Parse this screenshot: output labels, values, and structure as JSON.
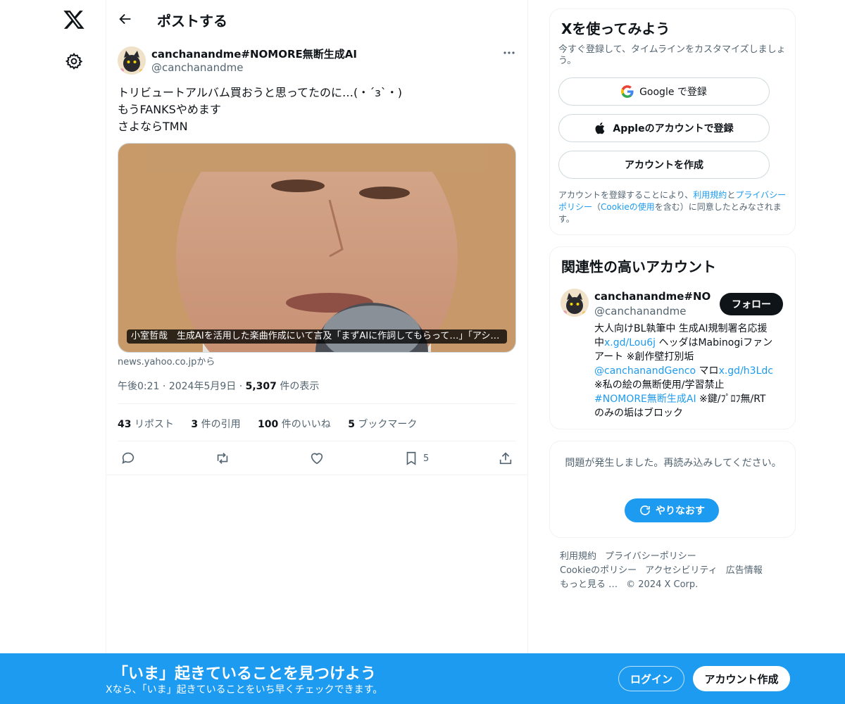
{
  "nav": {
    "logo_icon": "x-logo-icon",
    "settings_icon": "gear-icon"
  },
  "header": {
    "title": "ポストする"
  },
  "post": {
    "author_name": "canchanandme#NOMORE無断生成AI",
    "author_handle": "@canchanandme",
    "text_lines": [
      "トリビュートアルバム買おうと思ってたのに…(・´з`・)",
      "もうFANKSやめます",
      "さよならTMN"
    ],
    "card_caption": "小室哲哉　生成AIを活用した楽曲作成にいて言及「まずAIに作詞してもらって…」「アシ…",
    "card_source": "news.yahoo.co.jpから",
    "time": "午後0:21",
    "date": "2024年5月9日",
    "views_count": "5,307",
    "views_label": "件の表示",
    "stats": [
      {
        "count": "43",
        "label": "リポスト"
      },
      {
        "count": "3",
        "label": "件の引用"
      },
      {
        "count": "100",
        "label": "件のいいね"
      },
      {
        "count": "5",
        "label": "ブックマーク"
      }
    ],
    "bookmark_count": "5"
  },
  "signup_panel": {
    "title": "Xを使ってみよう",
    "subtitle": "今すぐ登録して、タイムラインをカスタマイズしましょう。",
    "google_label": "Google で登録",
    "apple_label": "Appleのアカウントで登録",
    "create_label": "アカウントを作成",
    "legal_1": "アカウントを登録することにより、",
    "legal_terms": "利用規約",
    "legal_2": "と",
    "legal_privacy": "プライバシーポリシー",
    "legal_3": "（",
    "legal_cookie": "Cookieの使用",
    "legal_4": "を含む）に同意したとみなされます。"
  },
  "related_panel": {
    "title": "関連性の高いアカウント",
    "name": "canchanandme#NOMORE無断生成AI",
    "handle": "@canchanandme",
    "follow_label": "フォロー",
    "bio_l1": "大人向けBL執筆中 生成AI規制署名応援",
    "bio_l2a": "中",
    "bio_l2link": "x.gd/Lou6j",
    "bio_l2b": " ヘッダはMabinogiファン",
    "bio_l3": "アート ※創作壁打別垢",
    "bio_l4link1": "@canchanandGenco",
    "bio_l4mid": " マロ",
    "bio_l4link2": "x.gd/h3Ldc",
    "bio_l5": "※私の絵の無断使用/学習禁止",
    "bio_l6link": "#NOMORE無断生成AI",
    "bio_l6b": " ※鍵/ﾌﾟﾛﾌ無/RT",
    "bio_l7": "のみの垢はブロック"
  },
  "error_panel": {
    "message": "問題が発生しました。再読み込みしてください。",
    "retry_label": "やりなおす"
  },
  "footer": {
    "links": [
      "利用規約",
      "プライバシーポリシー",
      "Cookieのポリシー",
      "アクセシビリティ",
      "広告情報",
      "もっと見る …"
    ],
    "copyright": "© 2024 X Corp."
  },
  "bottom_bar": {
    "title": "「いま」起きていることを見つけよう",
    "subtitle": "Xなら、「いま」起きていることをいち早くチェックできます。",
    "login_label": "ログイン",
    "signup_label": "アカウント作成"
  },
  "colors": {
    "accent": "#1d9bf0",
    "text": "#0f1419",
    "muted": "#536471",
    "border": "#cfd9de"
  }
}
